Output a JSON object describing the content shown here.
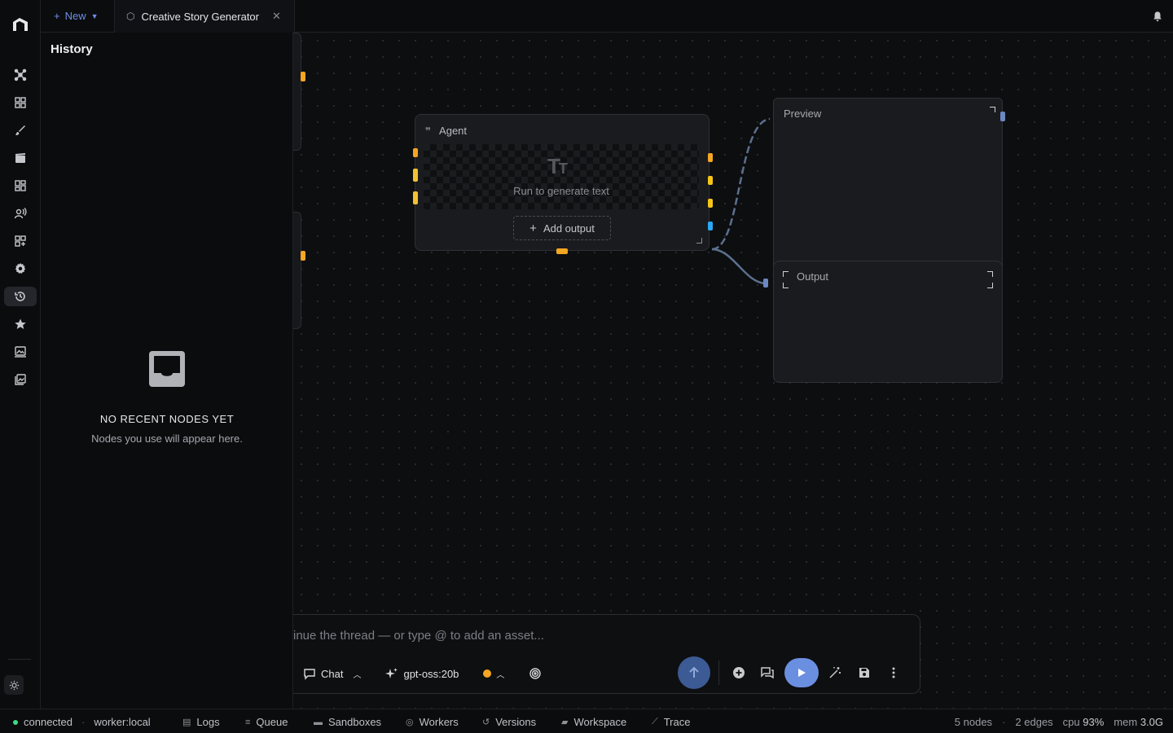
{
  "topbar": {
    "new_label": "New",
    "tab_title": "Creative Story Generator"
  },
  "history": {
    "title": "History",
    "empty_title": "NO RECENT NODES YET",
    "empty_subtitle": "Nodes you use will appear here."
  },
  "canvas": {
    "agent_node": {
      "title": "Agent",
      "placeholder_text": "Run to generate text",
      "add_output_label": "Add output"
    },
    "preview_node": {
      "title": "Preview"
    },
    "output_node": {
      "title": "Output"
    }
  },
  "chat": {
    "placeholder": "inue the thread — or type @ to add an asset...",
    "mode_label": "Chat",
    "model_label": "gpt-oss:20b"
  },
  "statusbar": {
    "connection": "connected",
    "worker": "worker:local",
    "logs": "Logs",
    "queue": "Queue",
    "sandboxes": "Sandboxes",
    "workers": "Workers",
    "versions": "Versions",
    "workspace": "Workspace",
    "trace": "Trace",
    "nodes": "5 nodes",
    "edges": "2 edges",
    "cpu_label": "cpu",
    "cpu_value": "93%",
    "mem_label": "mem",
    "mem_value": "3.0G"
  },
  "colors": {
    "accent": "#6b8fe0",
    "handle_orange": "#f5a623",
    "handle_yellow": "#f2c230",
    "handle_blue": "#2aa8f2",
    "status_green": "#3ddc84"
  },
  "icons": {
    "rail": [
      "network-icon",
      "grid-icon",
      "brush-icon",
      "film-icon",
      "dashboard-icon",
      "voice-icon",
      "apps-add-icon",
      "gear-icon",
      "history-icon",
      "star-icon",
      "image-collection-icon",
      "gallery-icon"
    ]
  }
}
